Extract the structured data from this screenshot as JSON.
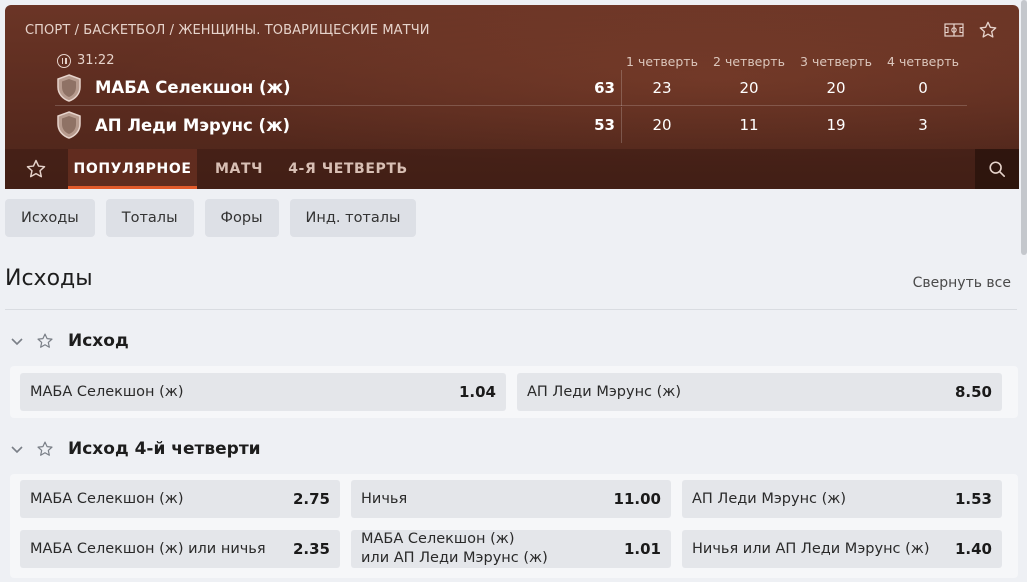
{
  "breadcrumb": "СПОРТ / БАСКЕТБОЛ / ЖЕНЩИНЫ. ТОВАРИЩЕСКИЕ МАТЧИ",
  "timer": "31:22",
  "quarters": [
    "1 четверть",
    "2 четверть",
    "3 четверть",
    "4 четверть"
  ],
  "teams": [
    {
      "name": "МАБА Селекшон (ж)",
      "score": "63",
      "quarters": [
        "23",
        "20",
        "20",
        "0"
      ]
    },
    {
      "name": "АП Леди Мэрунс (ж)",
      "score": "53",
      "quarters": [
        "20",
        "11",
        "19",
        "3"
      ]
    }
  ],
  "tabs": [
    "ПОПУЛЯРНОЕ",
    "МАТЧ",
    "4-Я ЧЕТВЕРТЬ"
  ],
  "chips": [
    "Исходы",
    "Тоталы",
    "Форы",
    "Инд. тоталы"
  ],
  "section": {
    "title": "Исходы",
    "collapse_label": "Свернуть все"
  },
  "markets": [
    {
      "title": "Исход",
      "rows": [
        [
          {
            "label": "МАБА Селекшон (ж)",
            "value": "1.04"
          },
          {
            "label": "АП Леди Мэрунс (ж)",
            "value": "8.50"
          }
        ]
      ]
    },
    {
      "title": "Исход 4-й четверти",
      "rows": [
        [
          {
            "label": "МАБА Селекшон (ж)",
            "value": "2.75"
          },
          {
            "label": "Ничья",
            "value": "11.00"
          },
          {
            "label": "АП Леди Мэрунс (ж)",
            "value": "1.53"
          }
        ],
        [
          {
            "label": "МАБА Селекшон (ж) или ничья",
            "value": "2.35"
          },
          {
            "label_line1": "МАБА Селекшон (ж)",
            "label_line2": "или АП Леди Мэрунс (ж)",
            "value": "1.01"
          },
          {
            "label": "Ничья или АП Леди Мэрунс (ж)",
            "value": "1.40"
          }
        ]
      ]
    }
  ],
  "icons": {
    "court": "basketball-court-icon",
    "favorite": "star-icon",
    "pause": "pause-icon",
    "team": "shield-icon",
    "search": "search-icon",
    "chevron": "chevron-down-icon"
  },
  "colors": {
    "accent": "#e25a2a",
    "header_bg": "#5a2b1f",
    "page_bg": "#eef0f4"
  }
}
